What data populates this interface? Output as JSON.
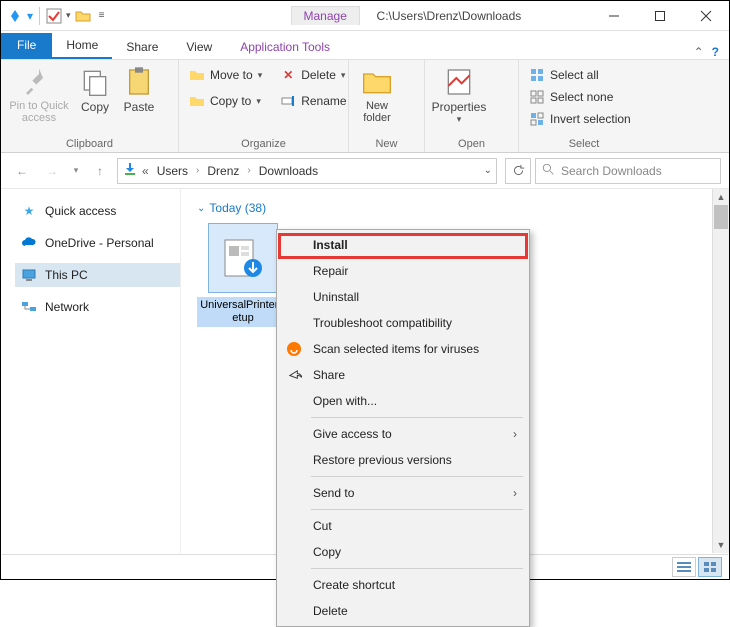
{
  "title": {
    "manage": "Manage",
    "path": "C:\\Users\\Drenz\\Downloads"
  },
  "tabs": {
    "file": "File",
    "home": "Home",
    "share": "Share",
    "view": "View",
    "apptools": "Application Tools"
  },
  "ribbon": {
    "clipboard": {
      "pin": "Pin to Quick access",
      "copy": "Copy",
      "paste": "Paste",
      "label": "Clipboard"
    },
    "organize": {
      "moveto": "Move to",
      "copyto": "Copy to",
      "delete": "Delete",
      "rename": "Rename",
      "label": "Organize"
    },
    "new": {
      "newfolder": "New folder",
      "label": "New"
    },
    "open": {
      "properties": "Properties",
      "label": "Open"
    },
    "select": {
      "selectall": "Select all",
      "selectnone": "Select none",
      "invert": "Invert selection",
      "label": "Select"
    }
  },
  "address": {
    "prefix": "«",
    "crumbs": [
      "Users",
      "Drenz",
      "Downloads"
    ]
  },
  "search": {
    "placeholder": "Search Downloads"
  },
  "nav": {
    "quick": "Quick access",
    "onedrive": "OneDrive - Personal",
    "thispc": "This PC",
    "network": "Network"
  },
  "content": {
    "groupLabel": "Today (38)",
    "fileLabel": "UniversalPrinterSetup"
  },
  "ctx": {
    "install": "Install",
    "repair": "Repair",
    "uninstall": "Uninstall",
    "troubleshoot": "Troubleshoot compatibility",
    "scan": "Scan selected items for viruses",
    "share": "Share",
    "openwith": "Open with...",
    "giveaccess": "Give access to",
    "restore": "Restore previous versions",
    "sendto": "Send to",
    "cut": "Cut",
    "copy": "Copy",
    "createshortcut": "Create shortcut",
    "delete": "Delete"
  }
}
